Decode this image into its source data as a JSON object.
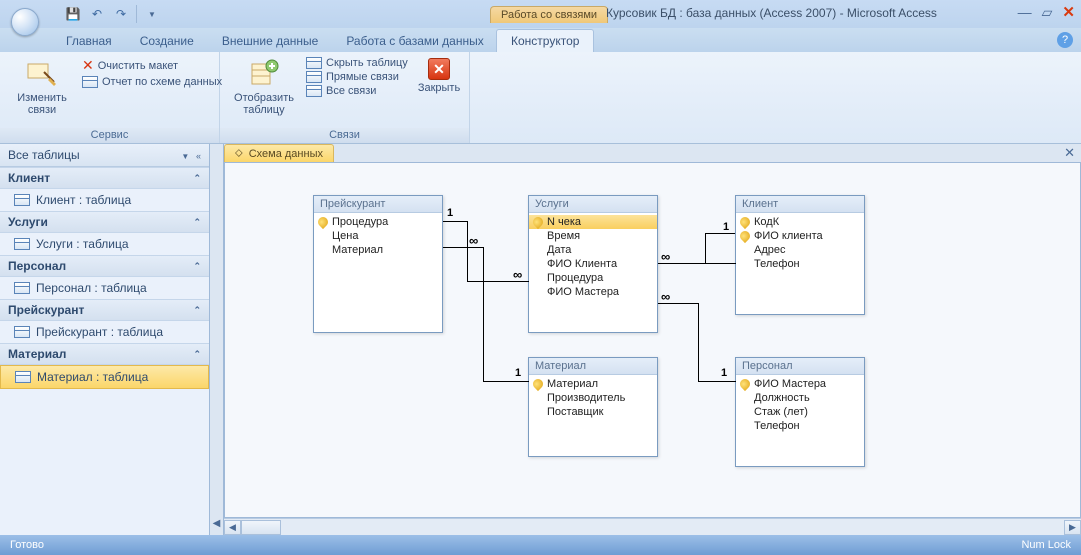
{
  "titlebar": {
    "context_tab": "Работа со связями",
    "title": "Курсовик БД : база данных (Access 2007) - Microsoft Access"
  },
  "tabs": {
    "t1": "Главная",
    "t2": "Создание",
    "t3": "Внешние данные",
    "t4": "Работа с базами данных",
    "ctx": "Конструктор"
  },
  "ribbon": {
    "g1": {
      "title": "Сервис",
      "edit_rel": "Изменить связи",
      "clear_layout": "Очистить макет",
      "rel_report": "Отчет по схеме данных"
    },
    "g2": {
      "title": "Связи",
      "show_table": "Отобразить таблицу",
      "hide_table": "Скрыть таблицу",
      "direct_rel": "Прямые связи",
      "all_rel": "Все связи",
      "close": "Закрыть"
    }
  },
  "nav": {
    "header": "Все таблицы",
    "groups": [
      {
        "hdr": "Клиент",
        "item": "Клиент : таблица"
      },
      {
        "hdr": "Услуги",
        "item": "Услуги : таблица"
      },
      {
        "hdr": "Персонал",
        "item": "Персонал : таблица"
      },
      {
        "hdr": "Прейскурант",
        "item": "Прейскурант : таблица"
      },
      {
        "hdr": "Материал",
        "item": "Материал : таблица"
      }
    ]
  },
  "doc_tab": "Схема данных",
  "entities": {
    "e1": {
      "title": "Прейскурант",
      "f1": "Процедура",
      "f2": "Цена",
      "f3": "Материал"
    },
    "e2": {
      "title": "Услуги",
      "f1": "N чека",
      "f2": "Время",
      "f3": "Дата",
      "f4": "ФИО Клиента",
      "f5": "Процедура",
      "f6": "ФИО Мастера"
    },
    "e3": {
      "title": "Клиент",
      "f1": "КодК",
      "f2": "ФИО клиента",
      "f3": "Адрес",
      "f4": "Телефон"
    },
    "e4": {
      "title": "Материал",
      "f1": "Материал",
      "f2": "Производитель",
      "f3": "Поставщик"
    },
    "e5": {
      "title": "Персонал",
      "f1": "ФИО Мастера",
      "f2": "Должность",
      "f3": "Стаж (лет)",
      "f4": "Телефон"
    }
  },
  "rel": {
    "one": "1",
    "many": "∞"
  },
  "status": {
    "ready": "Готово",
    "numlock": "Num Lock"
  }
}
